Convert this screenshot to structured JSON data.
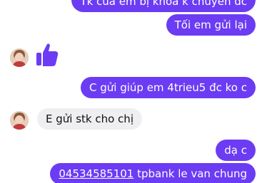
{
  "messages": {
    "m1_text": "Tk của em bị khóa k chuyển đc",
    "m2_text": "Tối em gửi lại",
    "m3_text": "C gửi giúp em 4trieu5 đc ko c",
    "m4_text": "E gửi stk cho chị",
    "m5_text": "dạ c",
    "m6_account": "04534585101",
    "m6_rest": " tpbank le van chung"
  },
  "icons": {
    "reaction": "thumbs-up-icon",
    "avatar": "contact-avatar"
  },
  "colors": {
    "outgoing_bubble": "#6b3cf3",
    "incoming_bubble": "#efeff2",
    "like": "#6b3cf3"
  }
}
